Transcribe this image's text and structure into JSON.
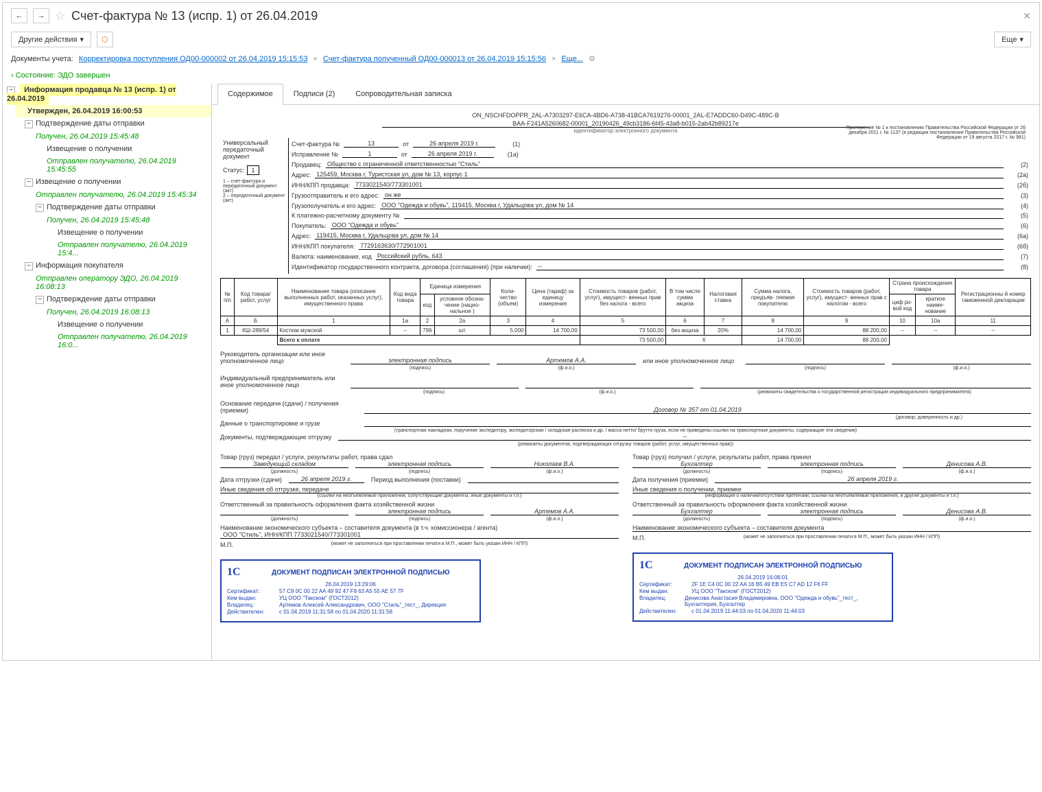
{
  "title": "Счет-фактура № 13 (испр. 1) от 26.04.2019",
  "toolbar": {
    "other_actions": "Другие действия",
    "more": "Еще"
  },
  "linkbar": {
    "label": "Документы учета:",
    "link1": "Корректировка поступления ОД00-000002 от 26.04.2019 15:15:53",
    "link2": "Счет-фактура полученный ОД00-000013 от 26.04.2019 15:15:56",
    "more": "Еще..."
  },
  "state": "Состояние: ЭДО завершен",
  "tree": {
    "root_title": "Информация продавца № 13 (испр. 1) от 26.04.2019",
    "root_sub": "Утвержден, 26.04.2019 16:00:53",
    "n1": "Подтверждение даты отправки",
    "n1s": "Получен, 26.04.2019 15:45:48",
    "n1a": "Извещение о получении",
    "n1as": "Отправлен получателю, 26.04.2019 15:45:55",
    "n2": "Извещение о получении",
    "n2s": "Отправлен получателю, 26.04.2019 15:45:34",
    "n2a": "Подтверждение даты отправки",
    "n2as": "Получен, 26.04.2019 15:45:48",
    "n2b": "Извещение о получении",
    "n2bs": "Отправлен получателю, 26.04.2019 15:4...",
    "n3": "Информация покупателя",
    "n3s": "Отправлен оператору ЭДО, 26.04.2019 16:08:13",
    "n3a": "Подтверждение даты отправки",
    "n3as": "Получен, 26.04.2019 16:08:13",
    "n3b": "Извещение о получении",
    "n3bs": "Отправлен получателю, 26.04.2019 16:0..."
  },
  "tabs": {
    "t1": "Содержимое",
    "t2": "Подписи (2)",
    "t3": "Сопроводительная записка"
  },
  "doc": {
    "id_line1": "ON_NSCHFDOPPR_2AL-A7303297-E6CA-4BD6-A738-41BCA7619276-00001_2AL-E7ADDC60-D49C-489C-B",
    "id_line2": "BAA-F241A5260682-00001_20190426_49cb3186-6f45-43a8-b015-2ab42b89217e",
    "id_label": "идентификатор электронного документа",
    "left1": "Универсальный передаточный документ",
    "status_label": "Статус:",
    "status_val": "1",
    "left_note1": "1 – счет-фактура и передаточный документ (акт)",
    "left_note2": "2 – передаточный документ (акт)",
    "top_note": "Приложение № 1 к постановлению Правительства Российской Федерации от 26 декабря 2011 г. № 1137 (в редакции постановления Правительства Российской Федерации от 19 августа 2017 г. № 981)",
    "f_sf_label": "Счет-фактура №",
    "f_sf_num": "13",
    "f_sf_ot": "от",
    "f_sf_date": "26 апреля 2019 г.",
    "f_sf_code": "(1)",
    "f_ispr_label": "Исправление №",
    "f_ispr_num": "1",
    "f_ispr_date": "26 апреля 2019 г.",
    "f_ispr_code": "(1а)",
    "f_seller": "Продавец:",
    "f_seller_val": "Общество с ограниченной ответственностью \"Стиль\"",
    "f_seller_code": "(2)",
    "f_addr": "Адрес:",
    "f_addr_val": "125459, Москва г, Туристская ул, дом № 13, корпус 1",
    "f_addr_code": "(2а)",
    "f_inn": "ИНН/КПП продавца:",
    "f_inn_val": "7733021540/773301001",
    "f_inn_code": "(2б)",
    "f_ship": "Грузоотправитель и его адрес:",
    "f_ship_val": "он же",
    "f_ship_code": "(3)",
    "f_cons": "Грузополучатель и его адрес:",
    "f_cons_val": "ООО \"Одежда и обувь\", 119415, Москва г, Удальцова ул, дом № 14",
    "f_cons_code": "(4)",
    "f_pay": "К платежно-расчетному документу №",
    "f_pay_code": "(5)",
    "f_buyer": "Покупатель:",
    "f_buyer_val": "ООО \"Одежда и обувь\"",
    "f_buyer_code": "(6)",
    "f_baddr": "Адрес:",
    "f_baddr_val": "119415, Москва г, Удальцова ул, дом № 14",
    "f_baddr_code": "(6а)",
    "f_binn": "ИНН/КПП покупателя:",
    "f_binn_val": "7729163630/772901001",
    "f_binn_code": "(6б)",
    "f_cur": "Валюта: наименование, код",
    "f_cur_val": "Российский рубль, 643",
    "f_cur_code": "(7)",
    "f_gos": "Идентификатор государственного контракта, договора (соглашения) (при наличии):",
    "f_gos_val": "--",
    "f_gos_code": "(8)"
  },
  "chart_data": {
    "type": "table",
    "headers_row1": [
      "№ п/п",
      "Код товара/ работ, услуг",
      "Наименование товара (описание выполненных работ, оказанных услуг), имущественного права",
      "Код вида товара",
      "Единица измерения",
      "",
      "Коли- чество (объем)",
      "Цена (тариф) за единицу измерения",
      "Стоимость товаров (работ, услуг), имущест- венных прав без налога - всего",
      "В том числе сумма акциза",
      "Налоговая ставка",
      "Сумма налога, предъяв- ляемая покупателю",
      "Стоимость товаров (работ, услуг), имущест- венных прав с налогом - всего",
      "Страна происхождения товара",
      "",
      "Регистрационны й номер таможенной декларации"
    ],
    "headers_row2": [
      "",
      "",
      "",
      "",
      "условное обозна- чение (нацио- нальное )",
      "",
      "",
      "",
      "",
      "",
      "",
      "",
      "",
      "циф ро- вой код",
      "краткое наиме- нование",
      ""
    ],
    "headers_code": [
      "А",
      "Б",
      "1",
      "1а",
      "2",
      "2а",
      "3",
      "4",
      "5",
      "6",
      "7",
      "8",
      "9",
      "10",
      "10а",
      "11"
    ],
    "headers_unit_code": "код",
    "rows": [
      {
        "n": "1",
        "code": "КШ-289/54",
        "name": "Костюм мужской",
        "kind": "--",
        "ucode": "796",
        "unit": "шт",
        "qty": "5,000",
        "price": "14 700,00",
        "sum_no_tax": "73 500,00",
        "excise": "без акциза",
        "rate": "20%",
        "tax": "14 700,00",
        "sum_tax": "88 200,00",
        "ccode": "--",
        "cname": "--",
        "decl": "--"
      }
    ],
    "total_label": "Всего к оплате",
    "total_sum_no_tax": "73 500,00",
    "total_x": "Х",
    "total_tax": "14 700,00",
    "total_sum_tax": "88 200,00"
  },
  "sig": {
    "head_label": "Руководитель организации или иное уполномоченное лицо",
    "esig": "электронная подпись",
    "head_name": "Артемов А.А.",
    "other_label": "или иное уполномоченное лицо",
    "ip_label": "Индивидуальный предприниматель или иное уполномоченное лицо",
    "sub_sign": "(подпись)",
    "sub_fio": "(ф.и.о.)",
    "sub_rekv": "(реквизиты свидетельства о государственной регистрации индивидуального предпринимателя)",
    "basis_label": "Основание передачи (сдачи) / получения (приемки)",
    "basis_val": "Договор № 357 от 01.04.2019",
    "basis_sub": "(договор; доверенность и др.)",
    "trans_label": "Данные о транспортировке и грузе",
    "trans_sub": "(транспортная накладная, поручение экспедитору, экспедиторская / складская расписка и др. / масса нетто/ брутто груза, если не приведены ссылки на транспортные документы, содержащие эти сведения)",
    "docs_label": "Документы, подтверждающие отгрузку",
    "docs_val": "--",
    "docs_sub": "(реквизиты документов, подтверждающих отгрузку товаров (работ, услуг, имущественных прав))"
  },
  "left_col": {
    "l1": "Товар (груз) передал / услуги, результаты работ, права сдал",
    "pos": "Заведующий складом",
    "name": "Николаев В.А.",
    "date_label": "Дата отгрузки (сдачи)",
    "date": "26 апреля 2019 г.",
    "period": "Период выполнения (поставки)",
    "other": "Иные сведения об отгрузке, передаче",
    "other_sub": "(ссылки на неотъемлемые приложения, сопутствующие документы, иные документы и т.п.)",
    "resp": "Ответственный за правильность оформления факта хозяйственной жизни",
    "resp_name": "Артемов А.А.",
    "org_label": "Наименование экономического субъекта – составителя документа (в т.ч. комиссионера / агента)",
    "org": "ООО \"Стиль\", ИНН/КПП 7733021540/773301001",
    "mp": "М.П.",
    "mp_sub": "(может не заполняться при проставлении печати в М.П., может быть указан ИНН / КПП)",
    "sub_pos": "(должность)"
  },
  "right_col": {
    "l1": "Товар (груз) получил / услуги, результаты работ, права принял",
    "pos": "Бухгалтер",
    "name": "Денисова А.В.",
    "date_label": "Дата получения (приемки)",
    "date": "26 апреля 2019 г.",
    "other": "Иные сведения о получении, приемке",
    "other_sub": "(информация о наличии/отсутствии претензии; ссылки на неотъемлемые приложения, и другие  документы и т.п.)",
    "resp": "Ответственный за правильность оформления факта хозяйственной жизни",
    "resp_name": "Денисова А.В.",
    "org_label": "Наименование экономического субъекта – составителя документа",
    "mp": "М.П.",
    "mp_sub": "(может не заполняться при проставлении печати в М.П., может быть указан ИНН / КПП)"
  },
  "stamp1": {
    "title": "ДОКУМЕНТ ПОДПИСАН ЭЛЕКТРОННОЙ ПОДПИСЬЮ",
    "date": "26.04.2019 13:29:06",
    "cert_l": "Сертификат:",
    "cert": "57 C9 0C 00 22 AA 49 92 47 F9 63 A5 55 AE 57 7F",
    "issued_l": "Кем выдан:",
    "issued": "УЦ ООО \"Такском\" (ГОСТ2012)",
    "owner_l": "Владелец:",
    "owner": "Артемов Алексей Александрович, ООО \"Стиль\"_тест_, Дирекция",
    "valid_l": "Действителен:",
    "valid": "с 01.04.2019 11:31:58 по 01.04.2020 11:31:58"
  },
  "stamp2": {
    "title": "ДОКУМЕНТ ПОДПИСАН ЭЛЕКТРОННОЙ ПОДПИСЬЮ",
    "date": "26.04.2019 16:06:01",
    "cert_l": "Сертификат:",
    "cert": "2F 1E C4 0C 00 22 AA 16 B5 49 EB E5 C7 AD 12 F6 FF",
    "issued_l": "Кем выдан:",
    "issued": "УЦ ООО \"Такском\" (ГОСТ2012)",
    "owner_l": "Владелец:",
    "owner": "Денисова Анастасия Владимировна, ООО \"Одежда и обувь\"_тест_, Бухгалтерия, Бухгалтер",
    "valid_l": "Действителен:",
    "valid": "с 01.04.2019 11:44:03 по 01.04.2020 11:44:03"
  }
}
